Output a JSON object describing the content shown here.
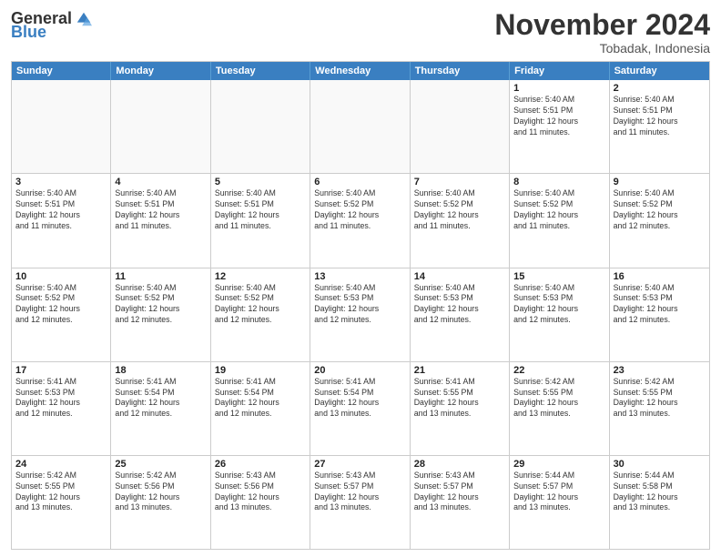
{
  "logo": {
    "general": "General",
    "blue": "Blue"
  },
  "title": "November 2024",
  "subtitle": "Tobadak, Indonesia",
  "days": [
    "Sunday",
    "Monday",
    "Tuesday",
    "Wednesday",
    "Thursday",
    "Friday",
    "Saturday"
  ],
  "rows": [
    [
      {
        "day": "",
        "info": "",
        "empty": true
      },
      {
        "day": "",
        "info": "",
        "empty": true
      },
      {
        "day": "",
        "info": "",
        "empty": true
      },
      {
        "day": "",
        "info": "",
        "empty": true
      },
      {
        "day": "",
        "info": "",
        "empty": true
      },
      {
        "day": "1",
        "info": "Sunrise: 5:40 AM\nSunset: 5:51 PM\nDaylight: 12 hours\nand 11 minutes."
      },
      {
        "day": "2",
        "info": "Sunrise: 5:40 AM\nSunset: 5:51 PM\nDaylight: 12 hours\nand 11 minutes."
      }
    ],
    [
      {
        "day": "3",
        "info": "Sunrise: 5:40 AM\nSunset: 5:51 PM\nDaylight: 12 hours\nand 11 minutes."
      },
      {
        "day": "4",
        "info": "Sunrise: 5:40 AM\nSunset: 5:51 PM\nDaylight: 12 hours\nand 11 minutes."
      },
      {
        "day": "5",
        "info": "Sunrise: 5:40 AM\nSunset: 5:51 PM\nDaylight: 12 hours\nand 11 minutes."
      },
      {
        "day": "6",
        "info": "Sunrise: 5:40 AM\nSunset: 5:52 PM\nDaylight: 12 hours\nand 11 minutes."
      },
      {
        "day": "7",
        "info": "Sunrise: 5:40 AM\nSunset: 5:52 PM\nDaylight: 12 hours\nand 11 minutes."
      },
      {
        "day": "8",
        "info": "Sunrise: 5:40 AM\nSunset: 5:52 PM\nDaylight: 12 hours\nand 11 minutes."
      },
      {
        "day": "9",
        "info": "Sunrise: 5:40 AM\nSunset: 5:52 PM\nDaylight: 12 hours\nand 12 minutes."
      }
    ],
    [
      {
        "day": "10",
        "info": "Sunrise: 5:40 AM\nSunset: 5:52 PM\nDaylight: 12 hours\nand 12 minutes."
      },
      {
        "day": "11",
        "info": "Sunrise: 5:40 AM\nSunset: 5:52 PM\nDaylight: 12 hours\nand 12 minutes."
      },
      {
        "day": "12",
        "info": "Sunrise: 5:40 AM\nSunset: 5:52 PM\nDaylight: 12 hours\nand 12 minutes."
      },
      {
        "day": "13",
        "info": "Sunrise: 5:40 AM\nSunset: 5:53 PM\nDaylight: 12 hours\nand 12 minutes."
      },
      {
        "day": "14",
        "info": "Sunrise: 5:40 AM\nSunset: 5:53 PM\nDaylight: 12 hours\nand 12 minutes."
      },
      {
        "day": "15",
        "info": "Sunrise: 5:40 AM\nSunset: 5:53 PM\nDaylight: 12 hours\nand 12 minutes."
      },
      {
        "day": "16",
        "info": "Sunrise: 5:40 AM\nSunset: 5:53 PM\nDaylight: 12 hours\nand 12 minutes."
      }
    ],
    [
      {
        "day": "17",
        "info": "Sunrise: 5:41 AM\nSunset: 5:53 PM\nDaylight: 12 hours\nand 12 minutes."
      },
      {
        "day": "18",
        "info": "Sunrise: 5:41 AM\nSunset: 5:54 PM\nDaylight: 12 hours\nand 12 minutes."
      },
      {
        "day": "19",
        "info": "Sunrise: 5:41 AM\nSunset: 5:54 PM\nDaylight: 12 hours\nand 12 minutes."
      },
      {
        "day": "20",
        "info": "Sunrise: 5:41 AM\nSunset: 5:54 PM\nDaylight: 12 hours\nand 13 minutes."
      },
      {
        "day": "21",
        "info": "Sunrise: 5:41 AM\nSunset: 5:55 PM\nDaylight: 12 hours\nand 13 minutes."
      },
      {
        "day": "22",
        "info": "Sunrise: 5:42 AM\nSunset: 5:55 PM\nDaylight: 12 hours\nand 13 minutes."
      },
      {
        "day": "23",
        "info": "Sunrise: 5:42 AM\nSunset: 5:55 PM\nDaylight: 12 hours\nand 13 minutes."
      }
    ],
    [
      {
        "day": "24",
        "info": "Sunrise: 5:42 AM\nSunset: 5:55 PM\nDaylight: 12 hours\nand 13 minutes."
      },
      {
        "day": "25",
        "info": "Sunrise: 5:42 AM\nSunset: 5:56 PM\nDaylight: 12 hours\nand 13 minutes."
      },
      {
        "day": "26",
        "info": "Sunrise: 5:43 AM\nSunset: 5:56 PM\nDaylight: 12 hours\nand 13 minutes."
      },
      {
        "day": "27",
        "info": "Sunrise: 5:43 AM\nSunset: 5:57 PM\nDaylight: 12 hours\nand 13 minutes."
      },
      {
        "day": "28",
        "info": "Sunrise: 5:43 AM\nSunset: 5:57 PM\nDaylight: 12 hours\nand 13 minutes."
      },
      {
        "day": "29",
        "info": "Sunrise: 5:44 AM\nSunset: 5:57 PM\nDaylight: 12 hours\nand 13 minutes."
      },
      {
        "day": "30",
        "info": "Sunrise: 5:44 AM\nSunset: 5:58 PM\nDaylight: 12 hours\nand 13 minutes."
      }
    ]
  ]
}
